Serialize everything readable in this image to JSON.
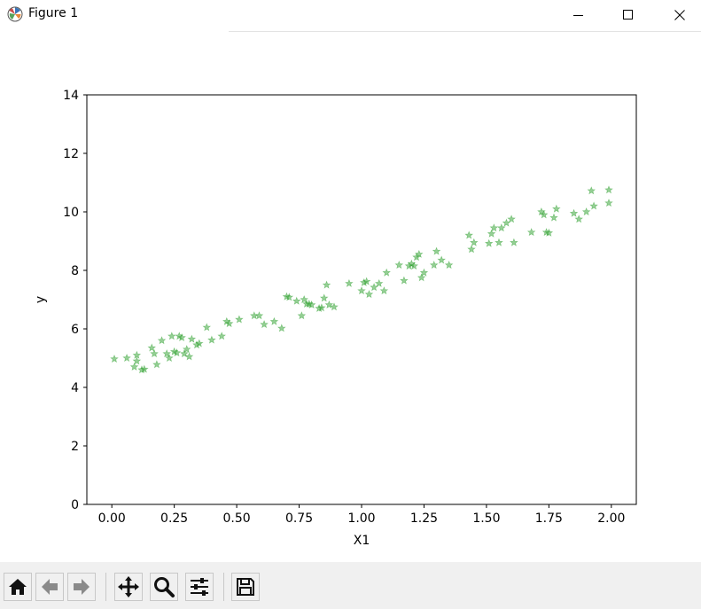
{
  "window": {
    "title": "Figure 1",
    "icons": [
      "matplotlib-logo-icon",
      "minimize-icon",
      "maximize-icon",
      "close-icon"
    ]
  },
  "toolbar": {
    "buttons": [
      "home-icon",
      "back-arrow-icon",
      "forward-arrow-icon",
      "pan-move-icon",
      "zoom-magnifier-icon",
      "configure-subplots-icon",
      "save-floppy-icon"
    ]
  },
  "chart_data": {
    "type": "scatter",
    "title": "",
    "xlabel": "X1",
    "ylabel": "y",
    "xlim": [
      -0.1,
      2.1
    ],
    "ylim": [
      0,
      14
    ],
    "xticks": [
      "0.00",
      "0.25",
      "0.50",
      "0.75",
      "1.00",
      "1.25",
      "1.50",
      "1.75",
      "2.00"
    ],
    "xtick_values": [
      0,
      0.25,
      0.5,
      0.75,
      1.0,
      1.25,
      1.5,
      1.75,
      2.0
    ],
    "yticks": [
      "0",
      "2",
      "4",
      "6",
      "8",
      "10",
      "12",
      "14"
    ],
    "ytick_values": [
      0,
      2,
      4,
      6,
      8,
      10,
      12,
      14
    ],
    "grid": false,
    "marker": "*",
    "color": "#2ca02c",
    "alpha": 0.5,
    "series": [
      {
        "x": [
          0.01,
          0.06,
          0.09,
          0.1,
          0.1,
          0.12,
          0.13,
          0.16,
          0.17,
          0.18,
          0.2,
          0.22,
          0.23,
          0.24,
          0.25,
          0.26,
          0.27,
          0.28,
          0.29,
          0.3,
          0.31,
          0.32,
          0.34,
          0.35,
          0.38,
          0.4,
          0.44,
          0.46,
          0.47,
          0.51,
          0.57,
          0.59,
          0.61,
          0.65,
          0.68,
          0.7,
          0.71,
          0.74,
          0.76,
          0.77,
          0.78,
          0.79,
          0.8,
          0.83,
          0.84,
          0.85,
          0.86,
          0.87,
          0.89,
          0.95,
          1.0,
          1.01,
          1.02,
          1.03,
          1.05,
          1.07,
          1.09,
          1.1,
          1.15,
          1.17,
          1.19,
          1.2,
          1.21,
          1.22,
          1.23,
          1.24,
          1.25,
          1.29,
          1.3,
          1.32,
          1.35,
          1.43,
          1.44,
          1.45,
          1.51,
          1.52,
          1.53,
          1.55,
          1.56,
          1.58,
          1.6,
          1.61,
          1.68,
          1.72,
          1.73,
          1.74,
          1.75,
          1.77,
          1.78,
          1.85,
          1.87,
          1.9,
          1.92,
          1.93,
          1.99,
          1.99
        ],
        "y": [
          4.97,
          5.0,
          4.7,
          4.9,
          5.1,
          4.6,
          4.62,
          5.35,
          5.15,
          4.78,
          5.6,
          5.15,
          5.0,
          5.75,
          5.22,
          5.18,
          5.75,
          5.7,
          5.15,
          5.3,
          5.05,
          5.65,
          5.45,
          5.5,
          6.05,
          5.62,
          5.75,
          6.25,
          6.18,
          6.32,
          6.45,
          6.45,
          6.15,
          6.25,
          6.02,
          7.1,
          7.08,
          6.95,
          6.45,
          7.0,
          6.85,
          6.85,
          6.82,
          6.7,
          6.72,
          7.05,
          7.5,
          6.82,
          6.75,
          7.55,
          7.3,
          7.58,
          7.62,
          7.18,
          7.42,
          7.55,
          7.3,
          7.92,
          8.18,
          7.65,
          8.15,
          8.22,
          8.15,
          8.45,
          8.55,
          7.75,
          7.92,
          8.18,
          8.65,
          8.35,
          8.18,
          9.2,
          8.72,
          8.95,
          8.92,
          9.25,
          9.45,
          8.95,
          9.45,
          9.62,
          9.75,
          8.95,
          9.3,
          10.0,
          9.9,
          9.3,
          9.28,
          9.8,
          10.1,
          9.95,
          9.75,
          10.0,
          10.72,
          10.2,
          10.75,
          10.3
        ]
      }
    ]
  }
}
